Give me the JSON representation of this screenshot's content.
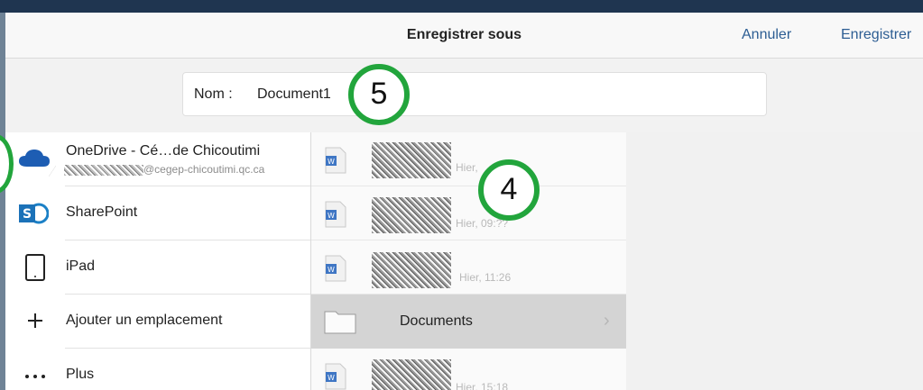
{
  "header": {
    "title": "Enregistrer sous",
    "cancel_label": "Annuler",
    "save_label": "Enregistrer"
  },
  "name_field": {
    "label": "Nom :",
    "value": "Document1"
  },
  "locations": [
    {
      "title": "OneDrive - Cé…de Chicoutimi",
      "subtitle": "@cegep-chicoutimi.qc.ca",
      "icon": "cloud-icon"
    },
    {
      "label": "SharePoint",
      "icon": "sharepoint-icon"
    },
    {
      "label": "iPad",
      "icon": "tablet-icon"
    },
    {
      "label": "Ajouter un emplacement",
      "icon": "plus-icon"
    },
    {
      "label": "Plus",
      "icon": "ellipsis-icon"
    }
  ],
  "files": [
    {
      "date": "Hier,",
      "icon": "word-icon"
    },
    {
      "date": "Hier, 09:??",
      "icon": "word-icon"
    },
    {
      "date": "Hier, 11:26",
      "icon": "word-icon"
    },
    {
      "folder_name": "Documents",
      "icon": "folder-icon"
    },
    {
      "date": "Hier, 15:18",
      "icon": "word-icon"
    }
  ],
  "callouts": {
    "name_step": "5",
    "files_step": "4"
  },
  "colors": {
    "accent": "#2c5d93",
    "callout": "#22a53c",
    "selection": "#d4d4d4"
  }
}
